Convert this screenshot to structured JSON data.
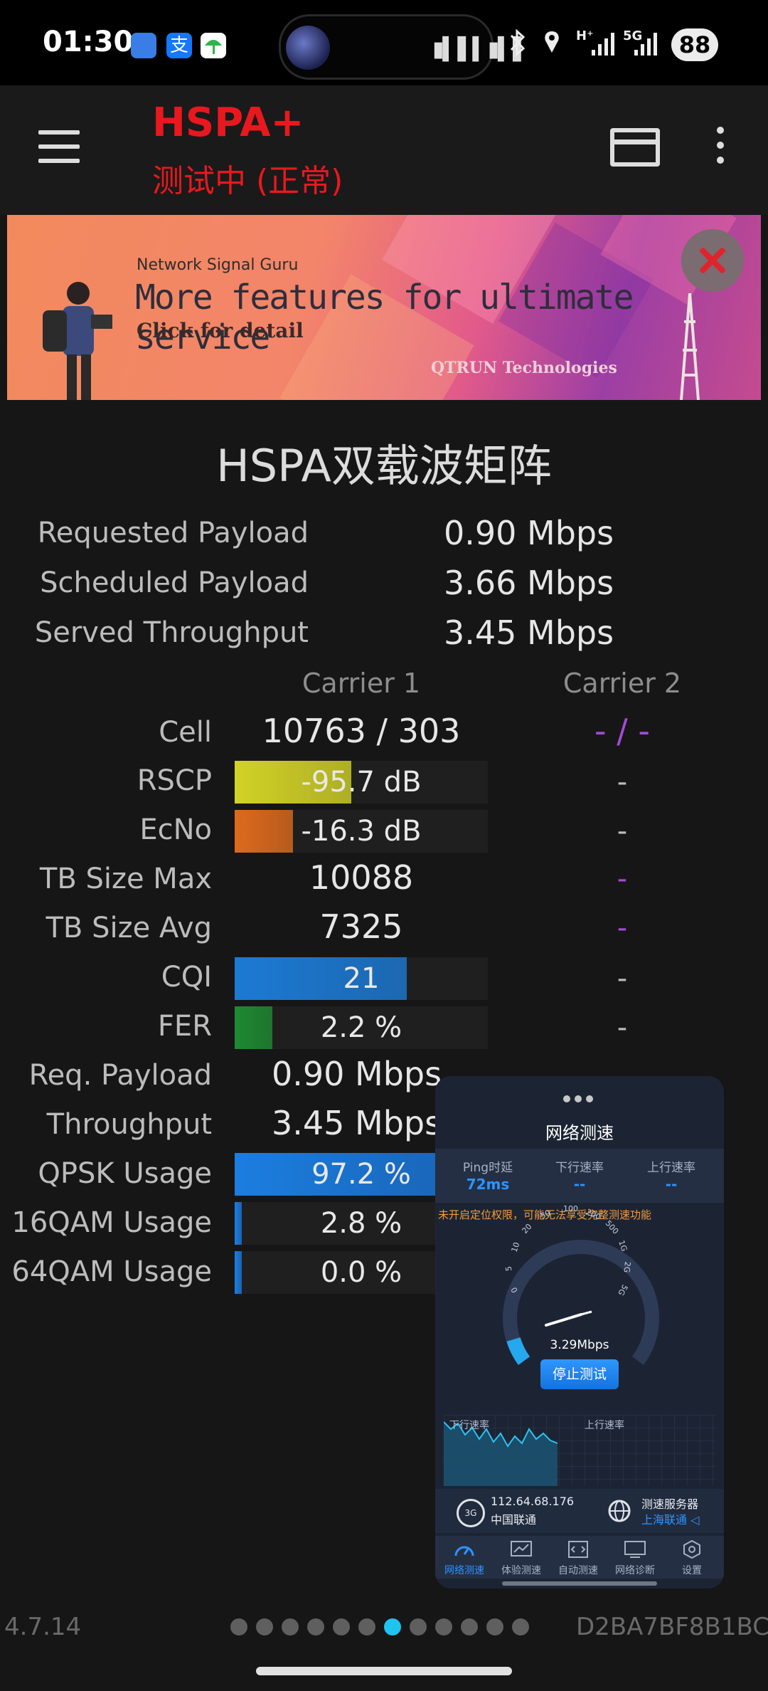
{
  "status_bar": {
    "time": "01:30",
    "battery": "88",
    "network_label": "5G",
    "hspa_label": "H⁺",
    "icons": [
      "app-icon-1",
      "alipay-icon",
      "umbrella-icon",
      "avatar",
      "waveform-icon",
      "bluetooth-icon",
      "location-icon",
      "signal-icon",
      "signal-icon-5g",
      "battery-icon"
    ]
  },
  "app_bar": {
    "network_type": "HSPA+",
    "status_text": "测试中 (正常)",
    "network_type_color": "#e8181e"
  },
  "banner": {
    "small": "Network Signal Guru",
    "headline": "More features for ultimate service",
    "cta": "Click for detail",
    "company": "QTRUN Technologies"
  },
  "section_title": "HSPA双载波矩阵",
  "summary": [
    {
      "label": "Requested Payload",
      "value": "0.90 Mbps"
    },
    {
      "label": "Scheduled Payload",
      "value": "3.66 Mbps"
    },
    {
      "label": "Served Throughput",
      "value": "3.45 Mbps"
    }
  ],
  "carrier_headers": [
    "Carrier 1",
    "Carrier 2"
  ],
  "cell": {
    "label": "Cell",
    "c1": "10763 / 303",
    "c2": "- / -"
  },
  "metrics": {
    "rscp": {
      "label": "RSCP",
      "c1": "-95.7 dB",
      "c2": "-",
      "level": 0.46,
      "color": "#d2d227"
    },
    "ecno": {
      "label": "EcNo",
      "c1": "-16.3 dB",
      "c2": "-",
      "level": 0.23,
      "color": "#dd6a1d"
    },
    "tbmax": {
      "label": "TB Size Max",
      "c1": "10088",
      "c2": "-"
    },
    "tbavg": {
      "label": "TB Size Avg",
      "c1": "7325",
      "c2": "-"
    },
    "cqi": {
      "label": "CQI",
      "c1": "21",
      "c2": "-",
      "level": 0.68,
      "color": "#1c7ad4"
    },
    "fer": {
      "label": "FER",
      "c1": "2.2 %",
      "c2": "-",
      "level": 0.15,
      "color": "#1e8a32"
    }
  },
  "lower": [
    {
      "label": "Req. Payload",
      "value": "0.90 Mbps"
    },
    {
      "label": "Throughput",
      "value": "3.45 Mbps"
    }
  ],
  "modulation": [
    {
      "label": "QPSK Usage",
      "value": "97.2 %",
      "level": 0.972
    },
    {
      "label": "16QAM Usage",
      "value": "2.8 %",
      "level": 0.028
    },
    {
      "label": "64QAM Usage",
      "value": "0.0 %",
      "level": 0.0
    }
  ],
  "footer": {
    "version": "4.7.14",
    "device_id": "D2BA7BF8B1BC",
    "page_count": 12,
    "active_page": 6
  },
  "speedtest": {
    "title": "网络测速",
    "ping_label": "Ping时延",
    "ping_value": "72ms",
    "down_label": "下行速率",
    "down_value": "--",
    "up_label": "上行速率",
    "up_value": "--",
    "warning": "未开启定位权限，可能无法享受完整测速功能",
    "gauge_ticks": [
      "0",
      "5",
      "10",
      "20",
      "50",
      "100",
      "200",
      "500",
      "1G",
      "2G",
      "5G"
    ],
    "speed": "3.29Mbps",
    "stop_button": "停止测试",
    "graph_down_label": "下行速率",
    "graph_up_label": "上行速率",
    "ip": "112.64.68.176",
    "isp": "中国联通",
    "network_badge": "3G",
    "server_label": "测速服务器",
    "server_name": "上海联通 ◁",
    "nav": [
      "网络测速",
      "体验测速",
      "自动测速",
      "网络诊断",
      "设置"
    ]
  }
}
